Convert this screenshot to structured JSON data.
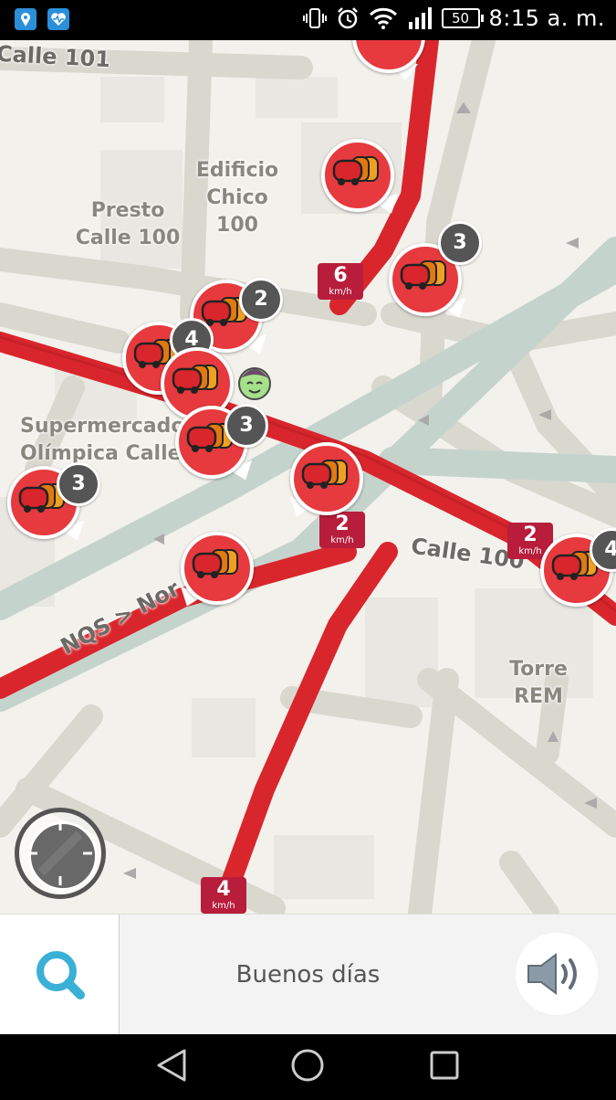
{
  "status_bar": {
    "battery": "50",
    "time": "8:15 a. m.",
    "icons": [
      "location-app-icon",
      "health-app-icon",
      "vibrate-icon",
      "alarm-icon",
      "wifi-icon",
      "signal-icon",
      "battery-icon"
    ]
  },
  "map": {
    "places": [
      {
        "name": "edificio-chico-100-label",
        "text": "Edificio\nChico 100"
      },
      {
        "name": "presto-calle-100-label",
        "text": "Presto\nCalle 100"
      },
      {
        "name": "supermercado-label",
        "text": "Supermercado\nOlímpica Calle"
      },
      {
        "name": "torre-rem-label",
        "text": "Torre REM"
      }
    ],
    "streets": {
      "calle_101": "Calle 101",
      "calle_100": "Calle 100",
      "nqs": "NQS > Nor"
    },
    "jam_counts": [
      "2",
      "4",
      "3",
      "3",
      "3",
      "4"
    ],
    "speeds": [
      {
        "value": "6",
        "unit": "km/h"
      },
      {
        "value": "2",
        "unit": "km/h"
      },
      {
        "value": "2",
        "unit": "km/h"
      },
      {
        "value": "4",
        "unit": "km/h"
      }
    ],
    "colors": {
      "traffic": "#d9262c",
      "road": "#d8d8cf",
      "highway": "#c5d3cd",
      "speed_badge": "#b81d3b"
    }
  },
  "bottom_bar": {
    "greeting": "Buenos días",
    "search_icon": "search-icon",
    "sound_icon": "speaker-icon",
    "accent": "#3ab0d6"
  },
  "nav_bar": {
    "icons": [
      "back-icon",
      "home-icon",
      "recents-icon"
    ]
  }
}
